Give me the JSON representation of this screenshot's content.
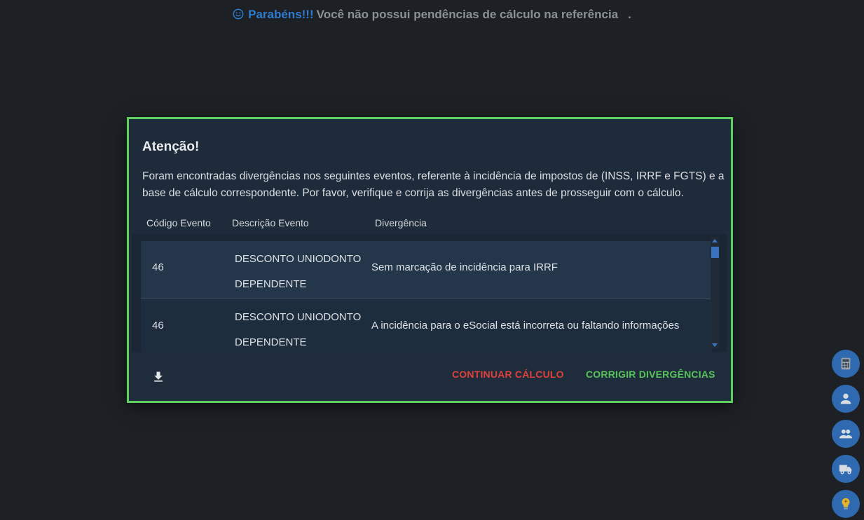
{
  "banner": {
    "congrats": "Parabéns!!!",
    "message": "Você não possui pendências de cálculo na referência",
    "trailing": "."
  },
  "dialog": {
    "title": "Atenção!",
    "text": "Foram encontradas divergências nos seguintes eventos, referente à incidência de impostos de (INSS, IRRF e FGTS) e a base de cálculo correspondente. Por favor, verifique e corrija as divergências antes de prosseguir com o cálculo.",
    "columns": {
      "code": "Código Evento",
      "description": "Descrição Evento",
      "divergence": "Divergência"
    },
    "rows": [
      {
        "code": "46",
        "description": "DESCONTO UNIODONTO DEPENDENTE",
        "divergence": "Sem marcação de incidência para IRRF"
      },
      {
        "code": "46",
        "description": "DESCONTO UNIODONTO DEPENDENTE",
        "divergence": "A incidência para o eSocial está incorreta ou faltando informações"
      }
    ],
    "buttons": {
      "continue": "CONTINUAR CÁLCULO",
      "fix": "CORRIGIR DIVERGÊNCIAS"
    }
  },
  "colors": {
    "accent_blue": "#2f7bd1",
    "dialog_border": "#5fcf5f",
    "continue_red": "#e0413a",
    "fix_green": "#57c45a"
  },
  "side_buttons": [
    "calculator-icon",
    "person-icon",
    "people-icon",
    "truck-icon",
    "lightbulb-icon"
  ]
}
